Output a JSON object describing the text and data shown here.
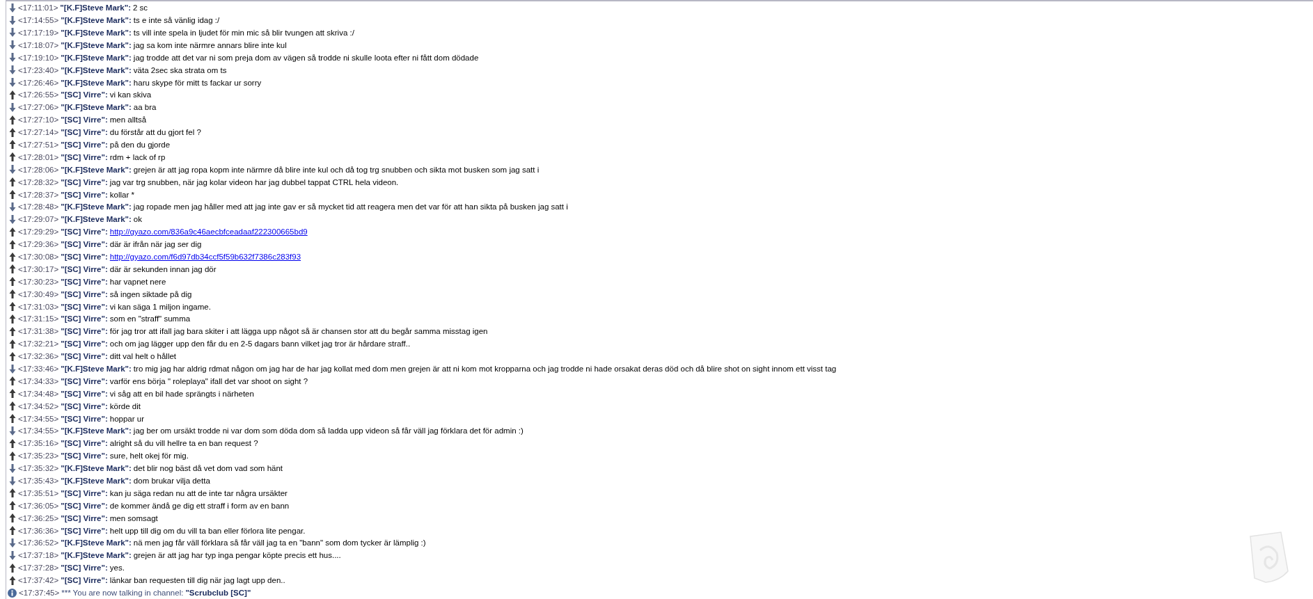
{
  "messages": [
    {
      "kind": "incoming",
      "time": "<17:11:01>",
      "sender": "\"[K.F]Steve Mark\":",
      "text": "2 sc"
    },
    {
      "kind": "incoming",
      "time": "<17:14:55>",
      "sender": "\"[K.F]Steve Mark\":",
      "text": "ts e inte så vänlig idag :/"
    },
    {
      "kind": "incoming",
      "time": "<17:17:19>",
      "sender": "\"[K.F]Steve Mark\":",
      "text": "ts vill inte spela in ljudet för min mic så blir tvungen att skriva :/"
    },
    {
      "kind": "incoming",
      "time": "<17:18:07>",
      "sender": "\"[K.F]Steve Mark\":",
      "text": "jag sa kom inte närmre annars blire inte kul"
    },
    {
      "kind": "incoming",
      "time": "<17:19:10>",
      "sender": "\"[K.F]Steve Mark\":",
      "text": "jag trodde att det var ni som preja dom av vägen så trodde ni skulle loota efter ni fått dom dödade"
    },
    {
      "kind": "incoming",
      "time": "<17:23:40>",
      "sender": "\"[K.F]Steve Mark\":",
      "text": "väta 2sec ska strata om ts"
    },
    {
      "kind": "incoming",
      "time": "<17:26:46>",
      "sender": "\"[K.F]Steve Mark\":",
      "text": "haru skype för mitt ts fackar ur sorry"
    },
    {
      "kind": "outgoing",
      "time": "<17:26:55>",
      "sender": "\"[SC] Virre\":",
      "text": "vi kan skiva"
    },
    {
      "kind": "incoming",
      "time": "<17:27:06>",
      "sender": "\"[K.F]Steve Mark\":",
      "text": "aa bra"
    },
    {
      "kind": "outgoing",
      "time": "<17:27:10>",
      "sender": "\"[SC] Virre\":",
      "text": "men alltså"
    },
    {
      "kind": "outgoing",
      "time": "<17:27:14>",
      "sender": "\"[SC] Virre\":",
      "text": "du förstår att du gjort fel ?"
    },
    {
      "kind": "outgoing",
      "time": "<17:27:51>",
      "sender": "\"[SC] Virre\":",
      "text": "på den du gjorde"
    },
    {
      "kind": "outgoing",
      "time": "<17:28:01>",
      "sender": "\"[SC] Virre\":",
      "text": "rdm + lack of rp"
    },
    {
      "kind": "incoming",
      "time": "<17:28:06>",
      "sender": "\"[K.F]Steve Mark\":",
      "text": "grejen är att jag ropa kopm inte närmre då blire inte kul och då tog trg snubben och sikta mot busken som jag satt i"
    },
    {
      "kind": "outgoing",
      "time": "<17:28:32>",
      "sender": "\"[SC] Virre\":",
      "text": "jag var trg snubben, när jag kolar videon har jag dubbel tappat CTRL hela videon."
    },
    {
      "kind": "outgoing",
      "time": "<17:28:37>",
      "sender": "\"[SC] Virre\":",
      "text": "kollar *"
    },
    {
      "kind": "incoming",
      "time": "<17:28:48>",
      "sender": "\"[K.F]Steve Mark\":",
      "text": "jag ropade men jag håller med att jag inte gav er så mycket tid att reagera men det var för att han sikta på busken jag satt i"
    },
    {
      "kind": "incoming",
      "time": "<17:29:07>",
      "sender": "\"[K.F]Steve Mark\":",
      "text": "ok"
    },
    {
      "kind": "outgoing",
      "time": "<17:29:29>",
      "sender": "\"[SC] Virre\":",
      "link": "http://gyazo.com/836a9c46aecbfceadaaf222300665bd9"
    },
    {
      "kind": "outgoing",
      "time": "<17:29:36>",
      "sender": "\"[SC] Virre\":",
      "text": "där är ifrån när jag ser dig"
    },
    {
      "kind": "outgoing",
      "time": "<17:30:08>",
      "sender": "\"[SC] Virre\":",
      "link": "http://gyazo.com/f6d97db34ccf5f59b632f7386c283f93"
    },
    {
      "kind": "outgoing",
      "time": "<17:30:17>",
      "sender": "\"[SC] Virre\":",
      "text": "där är sekunden innan jag dör"
    },
    {
      "kind": "outgoing",
      "time": "<17:30:23>",
      "sender": "\"[SC] Virre\":",
      "text": "har vapnet nere"
    },
    {
      "kind": "outgoing",
      "time": "<17:30:49>",
      "sender": "\"[SC] Virre\":",
      "text": "så ingen siktade på dig"
    },
    {
      "kind": "outgoing",
      "time": "<17:31:03>",
      "sender": "\"[SC] Virre\":",
      "text": "vi kan säga 1 miljon ingame."
    },
    {
      "kind": "outgoing",
      "time": "<17:31:15>",
      "sender": "\"[SC] Virre\":",
      "text": "som en \"straff\" summa"
    },
    {
      "kind": "outgoing",
      "time": "<17:31:38>",
      "sender": "\"[SC] Virre\":",
      "text": "för jag tror att ifall jag bara skiter i att lägga upp något så är chansen stor att du begår samma misstag igen"
    },
    {
      "kind": "outgoing",
      "time": "<17:32:21>",
      "sender": "\"[SC] Virre\":",
      "text": "och om jag lägger upp den får du en 2-5 dagars bann vilket jag tror är hårdare straff.."
    },
    {
      "kind": "outgoing",
      "time": "<17:32:36>",
      "sender": "\"[SC] Virre\":",
      "text": "ditt val helt o hållet"
    },
    {
      "kind": "incoming",
      "time": "<17:33:46>",
      "sender": "\"[K.F]Steve Mark\":",
      "text": "tro mig jag har aldrig rdmat någon om jag har de har jag kollat med dom men grejen är att ni kom mot kropparna och jag trodde ni hade orsakat deras död och då blire shot on sight innom ett visst tag"
    },
    {
      "kind": "outgoing",
      "time": "<17:34:33>",
      "sender": "\"[SC] Virre\":",
      "text": "varför ens börja \" roleplaya\" ifall det var shoot on sight ?"
    },
    {
      "kind": "outgoing",
      "time": "<17:34:48>",
      "sender": "\"[SC] Virre\":",
      "text": "vi såg att en bil hade sprängts i närheten"
    },
    {
      "kind": "outgoing",
      "time": "<17:34:52>",
      "sender": "\"[SC] Virre\":",
      "text": "körde dit"
    },
    {
      "kind": "outgoing",
      "time": "<17:34:55>",
      "sender": "\"[SC] Virre\":",
      "text": "hoppar ur"
    },
    {
      "kind": "incoming",
      "time": "<17:34:55>",
      "sender": "\"[K.F]Steve Mark\":",
      "text": "jag ber om ursäkt trodde ni var dom som döda dom så ladda upp videon så får väll jag förklara det för admin :)"
    },
    {
      "kind": "outgoing",
      "time": "<17:35:16>",
      "sender": "\"[SC] Virre\":",
      "text": "alright så du vill hellre ta en ban request ?"
    },
    {
      "kind": "outgoing",
      "time": "<17:35:23>",
      "sender": "\"[SC] Virre\":",
      "text": "sure, helt okej för mig."
    },
    {
      "kind": "incoming",
      "time": "<17:35:32>",
      "sender": "\"[K.F]Steve Mark\":",
      "text": "det blir nog bäst då vet dom vad som hänt"
    },
    {
      "kind": "incoming",
      "time": "<17:35:43>",
      "sender": "\"[K.F]Steve Mark\":",
      "text": "dom brukar vilja detta"
    },
    {
      "kind": "outgoing",
      "time": "<17:35:51>",
      "sender": "\"[SC] Virre\":",
      "text": "kan ju säga redan nu att de inte tar några ursäkter"
    },
    {
      "kind": "outgoing",
      "time": "<17:36:05>",
      "sender": "\"[SC] Virre\":",
      "text": "de kommer ändå ge dig ett straff i form av en bann"
    },
    {
      "kind": "outgoing",
      "time": "<17:36:25>",
      "sender": "\"[SC] Virre\":",
      "text": "men somsagt"
    },
    {
      "kind": "outgoing",
      "time": "<17:36:36>",
      "sender": "\"[SC] Virre\":",
      "text": "helt upp till dig om du vill ta ban eller förlora lite pengar."
    },
    {
      "kind": "incoming",
      "time": "<17:36:52>",
      "sender": "\"[K.F]Steve Mark\":",
      "text": "nä men jag får väll förklara så får väll jag ta en \"bann\" som dom tycker är lämplig :)"
    },
    {
      "kind": "incoming",
      "time": "<17:37:18>",
      "sender": "\"[K.F]Steve Mark\":",
      "text": "grejen är att jag har typ inga pengar köpte precis ett hus...."
    },
    {
      "kind": "outgoing",
      "time": "<17:37:28>",
      "sender": "\"[SC] Virre\":",
      "text": "yes."
    },
    {
      "kind": "outgoing",
      "time": "<17:37:42>",
      "sender": "\"[SC] Virre\":",
      "text": "länkar ban requesten till dig när jag lagt upp den.."
    },
    {
      "kind": "info",
      "time": "<17:37:45>",
      "text": "*** You are now talking in channel:",
      "channel": "\"Scrubclub [SC]\""
    }
  ]
}
